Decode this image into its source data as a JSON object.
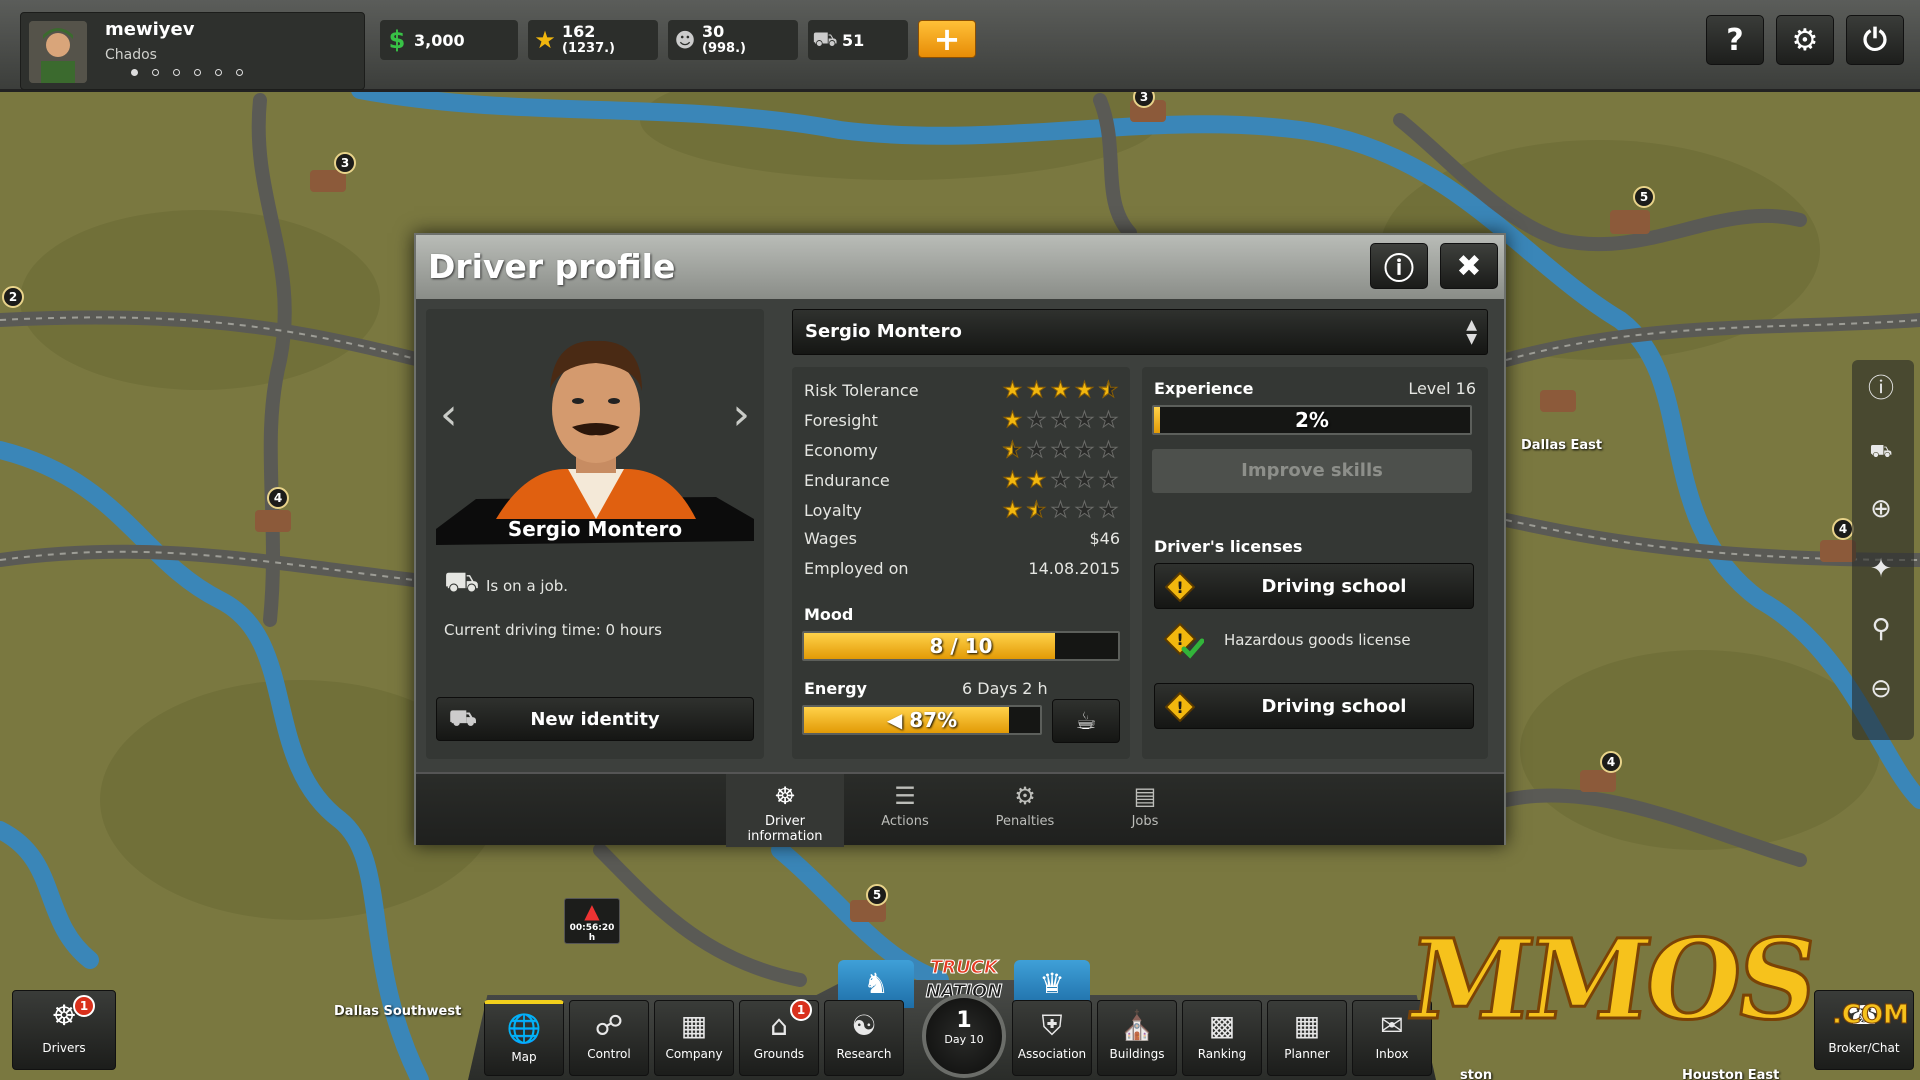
{
  "player": {
    "name": "mewiyev",
    "company": "Chados"
  },
  "resources": [
    {
      "icon": "dollar-icon",
      "value": "3,000"
    },
    {
      "icon": "star-icon",
      "value": "162",
      "sub": "(1237.)"
    },
    {
      "icon": "people-icon",
      "value": "30",
      "sub": "(998.)"
    },
    {
      "icon": "truck-icon",
      "value": "51"
    }
  ],
  "dialog": {
    "title": "Driver profile",
    "driver_name": "Sergio Montero",
    "portrait_name": "Sergio Montero",
    "status": "Is on a job.",
    "driving_time": "Current driving time: 0 hours",
    "new_identity": "New identity",
    "stats": [
      {
        "label": "Risk Tolerance",
        "stars": 4.5
      },
      {
        "label": "Foresight",
        "stars": 1
      },
      {
        "label": "Economy",
        "stars": 0.5
      },
      {
        "label": "Endurance",
        "stars": 2
      },
      {
        "label": "Loyalty",
        "stars": 1.5
      }
    ],
    "wages_label": "Wages",
    "wages": "$46",
    "employed_label": "Employed on",
    "employed": "14.08.2015",
    "mood_label": "Mood",
    "mood_text": "8 / 10",
    "mood_value": 0.8,
    "energy_label": "Energy",
    "energy_time": "6 Days 2 h",
    "energy_text": "87%",
    "energy_value": 0.87,
    "experience_label": "Experience",
    "level": "Level 16",
    "experience_text": "2%",
    "experience_value": 0.02,
    "improve_skills": "Improve skills",
    "licenses_label": "Driver's licenses",
    "license1": "Driving school",
    "license2": "Hazardous goods license",
    "license3": "Driving school",
    "tabs": [
      "Driver information",
      "Actions",
      "Penalties",
      "Jobs"
    ]
  },
  "bottom": {
    "drivers": "Drivers",
    "drivers_badge": "1",
    "items": [
      "Map",
      "Control",
      "Company",
      "Grounds",
      "Research",
      "Association",
      "Buildings",
      "Ranking",
      "Planner",
      "Inbox"
    ],
    "grounds_badge": "1",
    "day_number": "1",
    "day_label": "Day 10",
    "logo_line1": "TRUCK",
    "logo_line2": "NATION",
    "chat": "Broker/Chat",
    "timer": "00:56:20 h"
  },
  "map": {
    "labels": [
      "Dallas East",
      "Dallas Southwest",
      "Houston East",
      "ston"
    ],
    "pins": [
      "3",
      "3",
      "2",
      "5",
      "4",
      "4",
      "4",
      "5"
    ]
  },
  "watermark": {
    "main": "MMOS",
    "suffix": ".COM"
  },
  "colors": {
    "accent": "#f2b70e",
    "bar_fill": "#e29a06",
    "map_green": "#7d7a3e",
    "river": "#3a86b8",
    "badge": "#d9301c"
  }
}
